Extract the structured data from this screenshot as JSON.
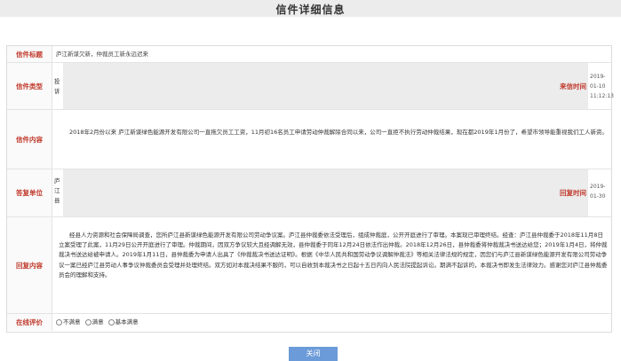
{
  "page": {
    "title": "信件详细信息"
  },
  "letter": {
    "title_label": "信件标题",
    "title_value": "庐江新谋欠新，仲裁员工新永远迟来",
    "type_label": "信件类型",
    "type_value": "投\n诉",
    "time_label": "来信时间",
    "time_value": "2019-\n01-10\n11:12:13",
    "content_label": "信件内容",
    "content_value": "2018年2月份以来 庐江新谋绿色能源开发有限公司一直拖欠员工工资，11月初16名员工申请劳动仲裁解除合同以来，公司一直拒不执行劳动仲裁结果，现在都2019年1月份了，希望市领导能重视我们工人新资。"
  },
  "reply": {
    "unit_label": "答复单位",
    "unit_value": "庐\n江\n县",
    "time_label": "回复时间",
    "time_value": "2019-\n01-30",
    "content_label": "回复内容",
    "content_value": "经县人力资源和社会保障局调查，您所庐江县新谋绿色能源开发有限公司劳动争议案。庐江县仲裁委依法受理后，组成仲裁庭，公开开庭进行了审理。本案现已审理终结。经查：庐江县仲裁委于2018年11月8日立案受理了此案，11月29日公开开庭进行了审理。仲裁期间，因双方争议较大且经调解无效，县仲裁委于同年12月24日依法作出仲裁。2018年12月26日，县仲裁委将仲裁裁决书送达给您；2019年1月4日，将仲裁裁决书送达给被申请人。2019年1月11日，县仲裁委为申请人出具了《仲裁裁决书送达证明》。根据《中华人民共和国劳动争议调解仲裁法》等相关法律法规的规定，因您们与庐江县新谋绿色能源开发有限公司劳动争议一案已经庐江县劳动人事争议仲裁委员会受理并处理终结。双方如对本裁决结果不服的，可以自收到本裁决书之日起十五日内向人民法院提起诉讼。期满不起诉的，本裁决书即发生法律效力。感谢您对庐江县仲裁委员会的理解和支持。"
  },
  "rating": {
    "label": "在线评价",
    "options": [
      "不满意",
      "满意",
      "基本满意"
    ]
  },
  "footer": {
    "close_label": "关闭"
  }
}
